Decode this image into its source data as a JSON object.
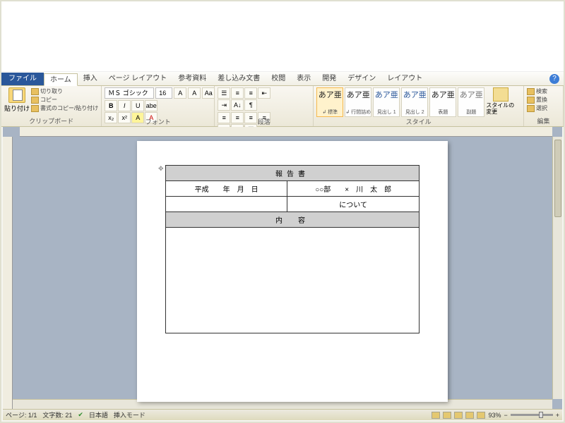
{
  "tabs": {
    "file": "ファイル",
    "home": "ホーム",
    "insert": "挿入",
    "pagelayout": "ページ レイアウト",
    "references": "参考資料",
    "mailings": "差し込み文書",
    "review": "校閲",
    "view": "表示",
    "developer": "開発",
    "design": "デザイン",
    "layout": "レイアウト"
  },
  "clipboard": {
    "paste": "貼り付け",
    "cut": "切り取り",
    "copy": "コピー",
    "formatpainter": "書式のコピー/貼り付け",
    "label": "クリップボード"
  },
  "font": {
    "name": "ＭＳ ゴシック",
    "size": "16",
    "label": "フォント"
  },
  "paragraph": {
    "label": "段落"
  },
  "styles": {
    "label": "スタイル",
    "sample": "あア亜",
    "items": [
      "↲ 標準",
      "↲ 行間詰め",
      "見出し 1",
      "見出し 2",
      "表題",
      "副題"
    ],
    "change": "スタイルの変更",
    "changeDrop": "▾"
  },
  "editing": {
    "find": "検索",
    "replace": "置換",
    "select": "選択",
    "label": "編集"
  },
  "document": {
    "title": "報告書",
    "dateRow": "平成　　年　月　日",
    "dept": "○○部　　×　川　太　郎",
    "subject": "について",
    "contentHeader": "内　容"
  },
  "status": {
    "page": "ページ: 1/1",
    "words": "文字数: 21",
    "lang": "日本語",
    "mode": "挿入モード",
    "zoom": "93%"
  }
}
